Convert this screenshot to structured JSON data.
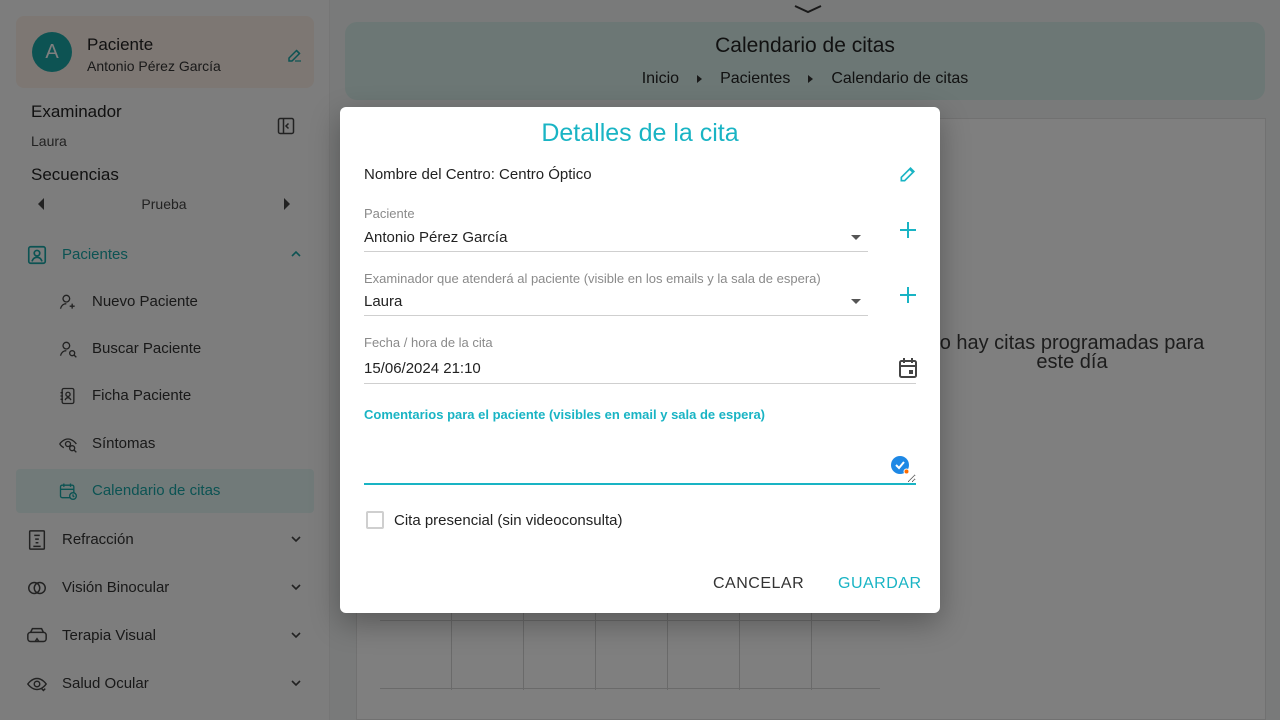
{
  "colors": {
    "accent": "#19b4c4",
    "teal_nav": "#19a6a6",
    "patient_card_bg": "#fbeee6",
    "header_bg": "#d8efeb"
  },
  "patient_card": {
    "avatar_letter": "A",
    "title": "Paciente",
    "name": "Antonio Pérez García",
    "edit_icon": "pencil-square-icon"
  },
  "examiner": {
    "label": "Examinador",
    "value": "Laura"
  },
  "sequences": {
    "label": "Secuencias",
    "current": "Prueba"
  },
  "nav": {
    "patients_group": "Pacientes",
    "sub_items": [
      {
        "label": "Nuevo Paciente",
        "icon": "user-plus-icon"
      },
      {
        "label": "Buscar Paciente",
        "icon": "user-search-icon"
      },
      {
        "label": "Ficha Paciente",
        "icon": "contact-book-icon"
      },
      {
        "label": "Síntomas",
        "icon": "eye-search-icon"
      },
      {
        "label": "Calendario de citas",
        "icon": "calendar-clock-icon"
      }
    ],
    "groups": [
      {
        "label": "Refracción",
        "icon": "eye-chart-icon"
      },
      {
        "label": "Visión Binocular",
        "icon": "rings-icon"
      },
      {
        "label": "Terapia Visual",
        "icon": "vr-glasses-icon"
      },
      {
        "label": "Salud Ocular",
        "icon": "eye-heart-icon"
      }
    ]
  },
  "header": {
    "title": "Calendario de citas",
    "breadcrumb": [
      "Inicio",
      "Pacientes",
      "Calendario de citas"
    ]
  },
  "calendar": {
    "empty_message": "o hay citas programadas para este día"
  },
  "dialog": {
    "title": "Detalles de la cita",
    "center": "Nombre del Centro: Centro Óptico",
    "patient_label": "Paciente",
    "patient_value": "Antonio Pérez García",
    "examiner_label": "Examinador que atenderá al paciente (visible en los emails y la sala de espera)",
    "examiner_value": "Laura",
    "date_label": "Fecha / hora de la cita",
    "date_value": "15/06/2024 21:10",
    "comments_label": "Comentarios para el paciente (visibles en email y sala de espera)",
    "comments_value": "",
    "in_person_label": "Cita presencial (sin videoconsulta)",
    "in_person_checked": false,
    "cancel": "CANCELAR",
    "save": "GUARDAR"
  }
}
